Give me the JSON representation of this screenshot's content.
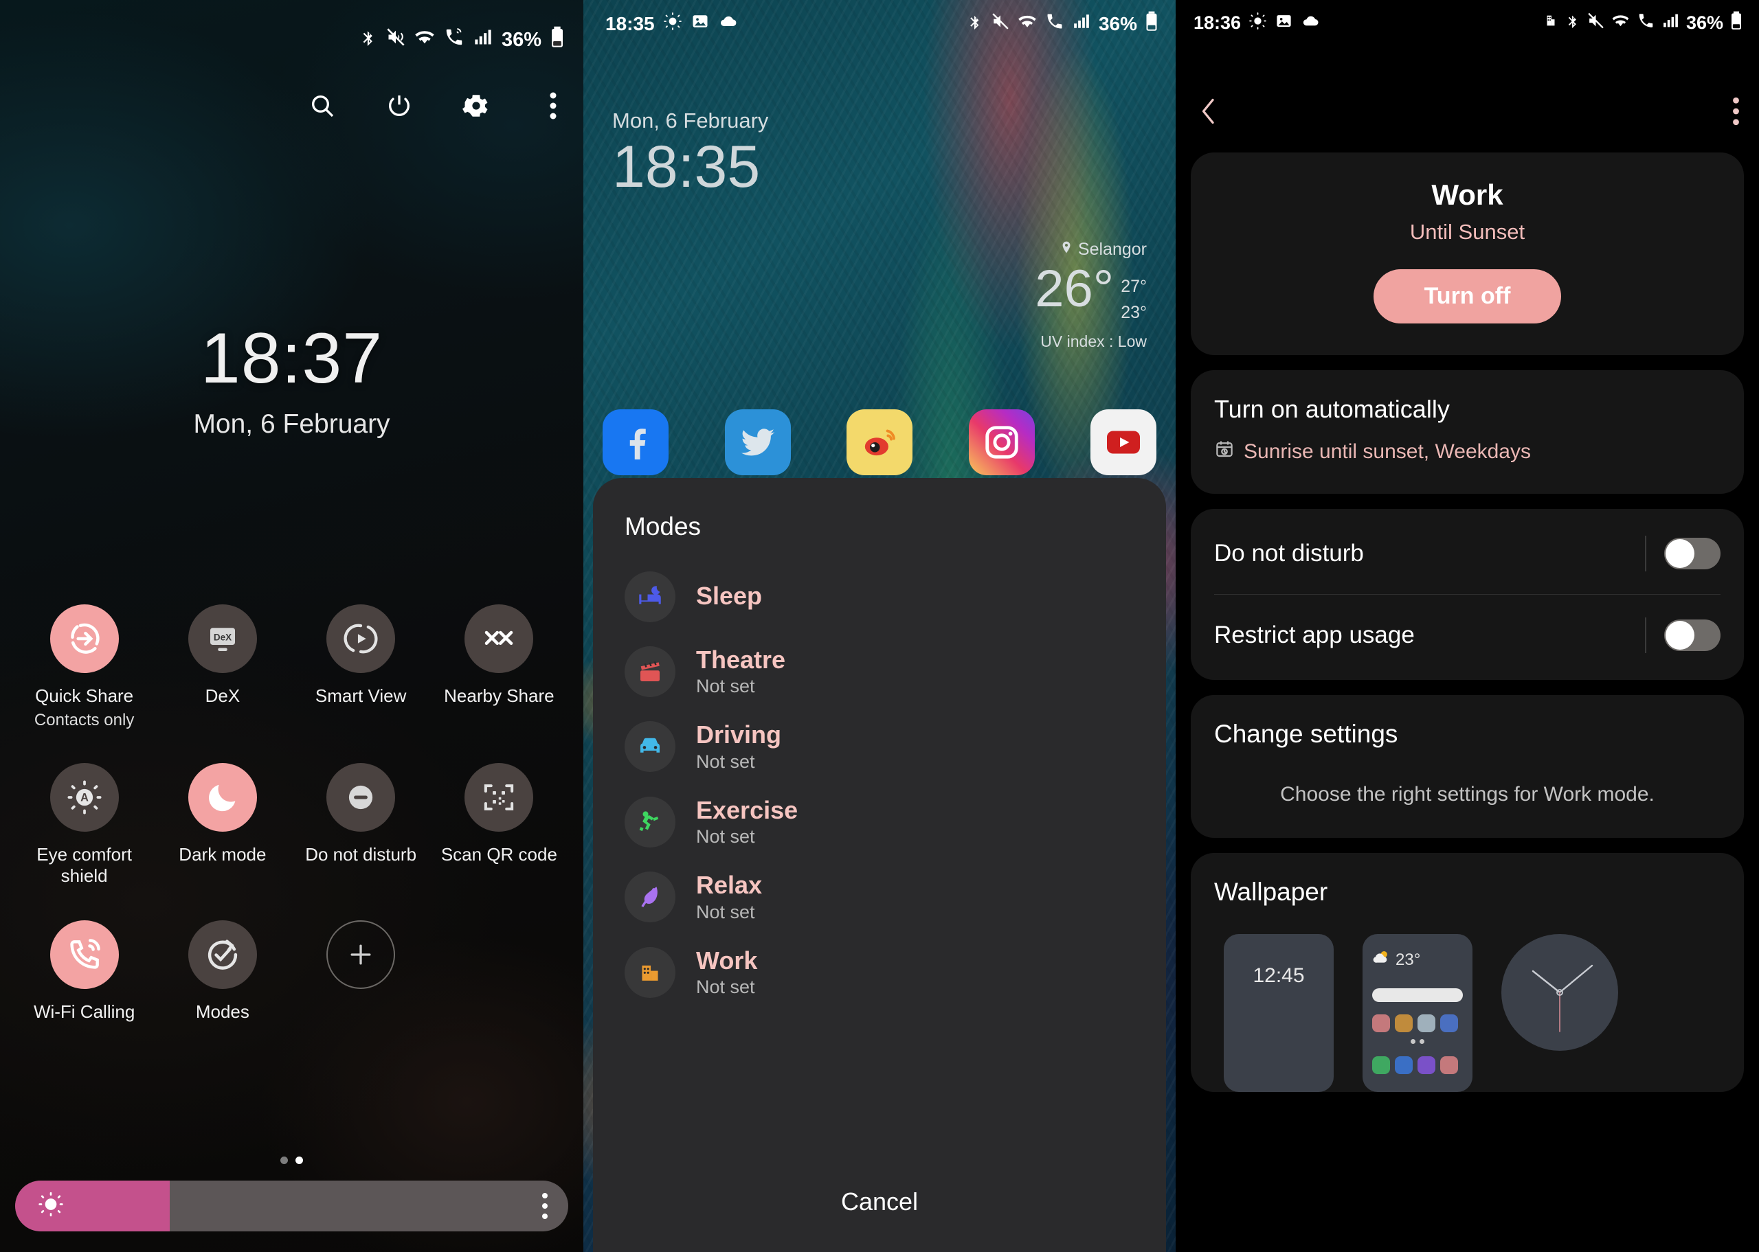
{
  "panel1": {
    "status_bar": {
      "battery_text": "36%",
      "icons": [
        "bluetooth-icon",
        "mute-vibrate-icon",
        "wifi-icon",
        "wifi-calling-icon",
        "signal-icon",
        "battery-icon"
      ]
    },
    "actions": [
      "search-icon",
      "power-icon",
      "settings-icon",
      "more-options-icon"
    ],
    "clock": {
      "time": "18:37",
      "date": "Mon, 6 February"
    },
    "tiles": [
      {
        "label": "Quick Share",
        "sub": "Contacts only",
        "state": "on",
        "icon": "quick-share-icon"
      },
      {
        "label": "DeX",
        "sub": "",
        "state": "off",
        "icon": "dex-icon"
      },
      {
        "label": "Smart View",
        "sub": "",
        "state": "off",
        "icon": "smart-view-icon"
      },
      {
        "label": "Nearby Share",
        "sub": "",
        "state": "off",
        "icon": "nearby-share-icon"
      },
      {
        "label": "Eye comfort shield",
        "sub": "",
        "state": "off",
        "icon": "eye-comfort-icon"
      },
      {
        "label": "Dark mode",
        "sub": "",
        "state": "on",
        "icon": "dark-mode-icon"
      },
      {
        "label": "Do not disturb",
        "sub": "",
        "state": "off",
        "icon": "do-not-disturb-icon"
      },
      {
        "label": "Scan QR code",
        "sub": "",
        "state": "off",
        "icon": "qr-code-icon"
      },
      {
        "label": "Wi-Fi Calling",
        "sub": "",
        "state": "on",
        "icon": "wifi-calling-icon"
      },
      {
        "label": "Modes",
        "sub": "",
        "state": "off",
        "icon": "modes-icon"
      },
      {
        "label": "",
        "sub": "",
        "state": "add",
        "icon": "plus-icon"
      }
    ],
    "brightness": {
      "percent": 28
    },
    "page_dots": 2,
    "active_dot": 2,
    "colors": {
      "accent": "#f3a3a3",
      "slider_fill": "#c4518c",
      "tile_bg": "#4a4240"
    }
  },
  "panel2": {
    "status_bar": {
      "time": "18:35",
      "battery_text": "36%",
      "left_icons": [
        "sun-icon",
        "image-icon",
        "cloud-icon"
      ],
      "right_icons": [
        "bluetooth-icon",
        "mute-vibrate-icon",
        "wifi-icon",
        "wifi-calling-icon",
        "signal-icon",
        "battery-icon"
      ]
    },
    "home": {
      "date": "Mon, 6 February",
      "time": "18:35"
    },
    "weather": {
      "location": "Selangor",
      "temp": "26",
      "degree": "°",
      "high": "27°",
      "low": "23°",
      "uv": "UV index : Low"
    },
    "dock": [
      {
        "name": "facebook-app-icon"
      },
      {
        "name": "twitter-app-icon"
      },
      {
        "name": "weibo-app-icon"
      },
      {
        "name": "instagram-app-icon"
      },
      {
        "name": "youtube-app-icon"
      }
    ],
    "modes_dialog": {
      "title": "Modes",
      "cancel_label": "Cancel",
      "items": [
        {
          "name": "Sleep",
          "status": "",
          "icon": "sleep-bed-icon",
          "color": "#4d5ae8"
        },
        {
          "name": "Theatre",
          "status": "Not set",
          "icon": "theatre-clapper-icon",
          "color": "#e05555"
        },
        {
          "name": "Driving",
          "status": "Not set",
          "icon": "driving-car-icon",
          "color": "#42b8e8"
        },
        {
          "name": "Exercise",
          "status": "Not set",
          "icon": "exercise-runner-icon",
          "color": "#3ed660"
        },
        {
          "name": "Relax",
          "status": "Not set",
          "icon": "relax-leaf-icon",
          "color": "#a972f0"
        },
        {
          "name": "Work",
          "status": "Not set",
          "icon": "work-building-icon",
          "color": "#eb9b30"
        }
      ]
    }
  },
  "panel3": {
    "status_bar": {
      "time": "18:36",
      "battery_text": "36%",
      "left_icons": [
        "sun-icon",
        "image-icon",
        "cloud-icon"
      ],
      "right_icons": [
        "work-mode-icon",
        "bluetooth-icon",
        "mute-vibrate-icon",
        "wifi-icon",
        "wifi-calling-icon",
        "signal-icon",
        "battery-icon"
      ]
    },
    "nav": {
      "back": "back-icon",
      "more": "more-options-icon"
    },
    "work_card": {
      "title": "Work",
      "subtitle": "Until Sunset",
      "button": "Turn off"
    },
    "auto_card": {
      "title": "Turn on automatically",
      "value": "Sunrise until sunset, Weekdays",
      "icon": "calendar-clock-icon"
    },
    "toggles": [
      {
        "label": "Do not disturb",
        "on": false
      },
      {
        "label": "Restrict app usage",
        "on": false
      }
    ],
    "change_settings": {
      "title": "Change settings",
      "desc": "Choose the right settings for Work mode."
    },
    "wallpaper": {
      "title": "Wallpaper",
      "lock_preview_time": "12:45",
      "home_preview_temp": "23°"
    },
    "colors": {
      "accent": "#f0a3a0",
      "card_bg": "#161616",
      "value_text": "#eab7b4"
    }
  }
}
